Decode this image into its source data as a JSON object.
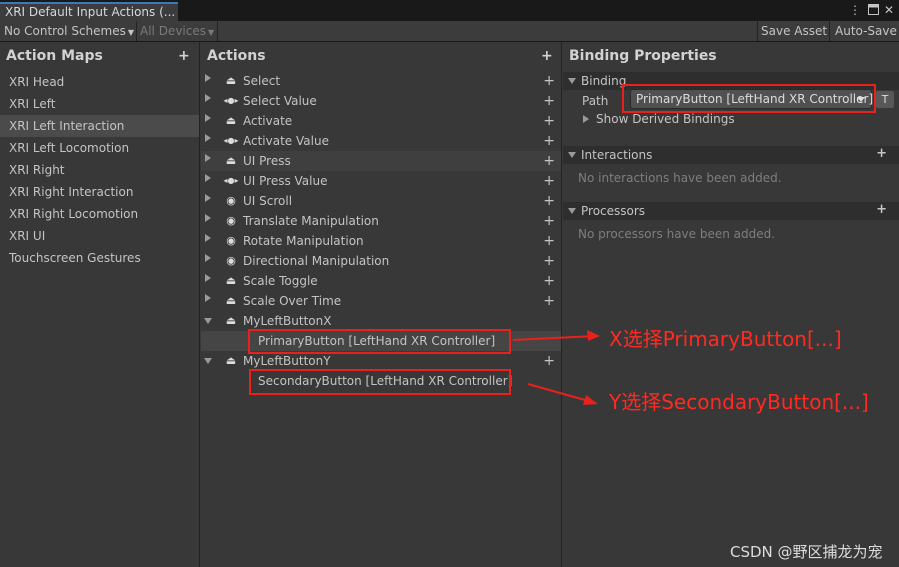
{
  "window": {
    "tab_title": "XRI Default Input Actions (...",
    "menu_icon": "kebab-menu-icon",
    "maximize_icon": "maximize-icon",
    "close_icon": "close-icon"
  },
  "toolbar": {
    "control_schemes": "No Control Schemes",
    "devices": "All Devices",
    "save_asset": "Save Asset",
    "auto_save": "Auto-Save"
  },
  "action_maps": {
    "title": "Action Maps",
    "add": "+",
    "items": [
      {
        "label": "XRI Head"
      },
      {
        "label": "XRI Left"
      },
      {
        "label": "XRI Left Interaction"
      },
      {
        "label": "XRI Left Locomotion"
      },
      {
        "label": "XRI Right"
      },
      {
        "label": "XRI Right Interaction"
      },
      {
        "label": "XRI Right Locomotion"
      },
      {
        "label": "XRI UI"
      },
      {
        "label": "Touchscreen Gestures"
      }
    ]
  },
  "actions": {
    "title": "Actions",
    "add": "+",
    "add_binding": "+",
    "items": [
      {
        "label": "Select",
        "icon": "button-action-icon",
        "glyph": "⏏"
      },
      {
        "label": "Select Value",
        "icon": "value-action-icon",
        "glyph": "◂●▸"
      },
      {
        "label": "Activate",
        "icon": "button-action-icon",
        "glyph": "⏏"
      },
      {
        "label": "Activate Value",
        "icon": "value-action-icon",
        "glyph": "◂●▸"
      },
      {
        "label": "UI Press",
        "icon": "button-action-icon",
        "glyph": "⏏"
      },
      {
        "label": "UI Press Value",
        "icon": "value-action-icon",
        "glyph": "◂●▸"
      },
      {
        "label": "UI Scroll",
        "icon": "passthrough-action-icon",
        "glyph": "◉"
      },
      {
        "label": "Translate Manipulation",
        "icon": "passthrough-action-icon",
        "glyph": "◉"
      },
      {
        "label": "Rotate Manipulation",
        "icon": "passthrough-action-icon",
        "glyph": "◉"
      },
      {
        "label": "Directional Manipulation",
        "icon": "passthrough-action-icon",
        "glyph": "◉"
      },
      {
        "label": "Scale Toggle",
        "icon": "button-action-icon",
        "glyph": "⏏"
      },
      {
        "label": "Scale Over Time",
        "icon": "button-action-icon",
        "glyph": "⏏"
      },
      {
        "label": "MyLeftButtonX",
        "icon": "button-action-icon",
        "glyph": "⏏"
      },
      {
        "label": "MyLeftButtonY",
        "icon": "button-action-icon",
        "glyph": "⏏"
      }
    ],
    "binding_x": "PrimaryButton [LeftHand XR Controller]",
    "binding_y": "SecondaryButton [LeftHand XR Controller]"
  },
  "binding_properties": {
    "title": "Binding Properties",
    "binding_section": "Binding",
    "path_label": "Path",
    "path_value": "PrimaryButton [LeftHand XR Controller]",
    "t_button": "T",
    "show_derived": "Show Derived Bindings",
    "interactions_section": "Interactions",
    "interactions_empty": "No interactions have been added.",
    "processors_section": "Processors",
    "processors_empty": "No processors have been added.",
    "add": "+"
  },
  "annotations": {
    "x_note": "X选择PrimaryButton[...]",
    "y_note": "Y选择SecondaryButton[...]",
    "color": "#e8211b"
  },
  "watermark": "CSDN @野区捕龙为宠"
}
